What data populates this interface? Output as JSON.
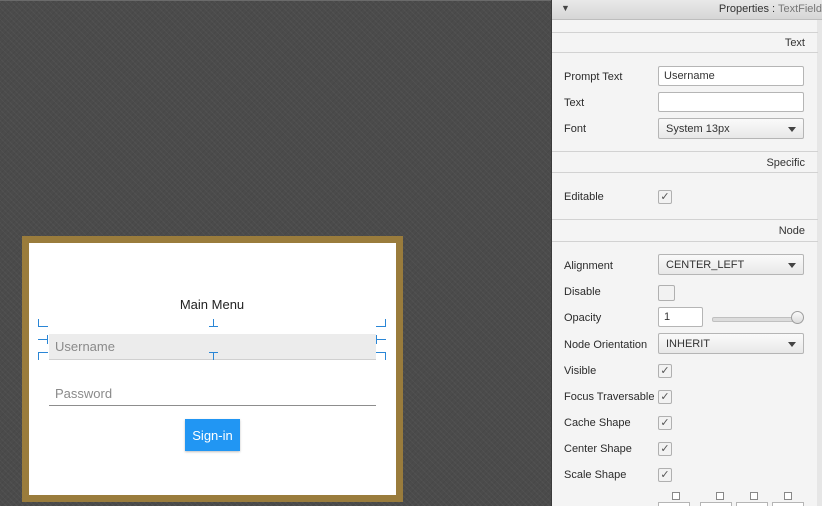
{
  "canvas": {
    "menu_title": "Main Menu",
    "username_placeholder": "Username",
    "password_placeholder": "Password",
    "signin_label": "Sign-in"
  },
  "panel": {
    "header_prefix": "Properties : ",
    "header_type": "TextField",
    "sections": {
      "text": "Text",
      "specific": "Specific",
      "node": "Node"
    },
    "prompt_text": {
      "label": "Prompt Text",
      "value": "Username"
    },
    "text": {
      "label": "Text",
      "value": ""
    },
    "font": {
      "label": "Font",
      "value": "System 13px"
    },
    "editable": {
      "label": "Editable",
      "checked": true
    },
    "alignment": {
      "label": "Alignment",
      "value": "CENTER_LEFT"
    },
    "disable": {
      "label": "Disable",
      "checked": false
    },
    "opacity": {
      "label": "Opacity",
      "value": "1",
      "slider_level": 1.0
    },
    "node_orientation": {
      "label": "Node Orientation",
      "value": "INHERIT"
    },
    "visible": {
      "label": "Visible",
      "checked": true
    },
    "focus_traversable": {
      "label": "Focus Traversable",
      "checked": true
    },
    "cache_shape": {
      "label": "Cache Shape",
      "checked": true
    },
    "center_shape": {
      "label": "Center Shape",
      "checked": true
    },
    "scale_shape": {
      "label": "Scale Shape",
      "checked": true
    }
  },
  "colors": {
    "accent": "#2196f3",
    "frame": "#9a7c3c",
    "selection_handles": "#2a86d6"
  },
  "icons": {
    "collapse": "triangle-down-icon",
    "check": "checkmark-icon",
    "dropdown": "chevron-down-icon"
  }
}
